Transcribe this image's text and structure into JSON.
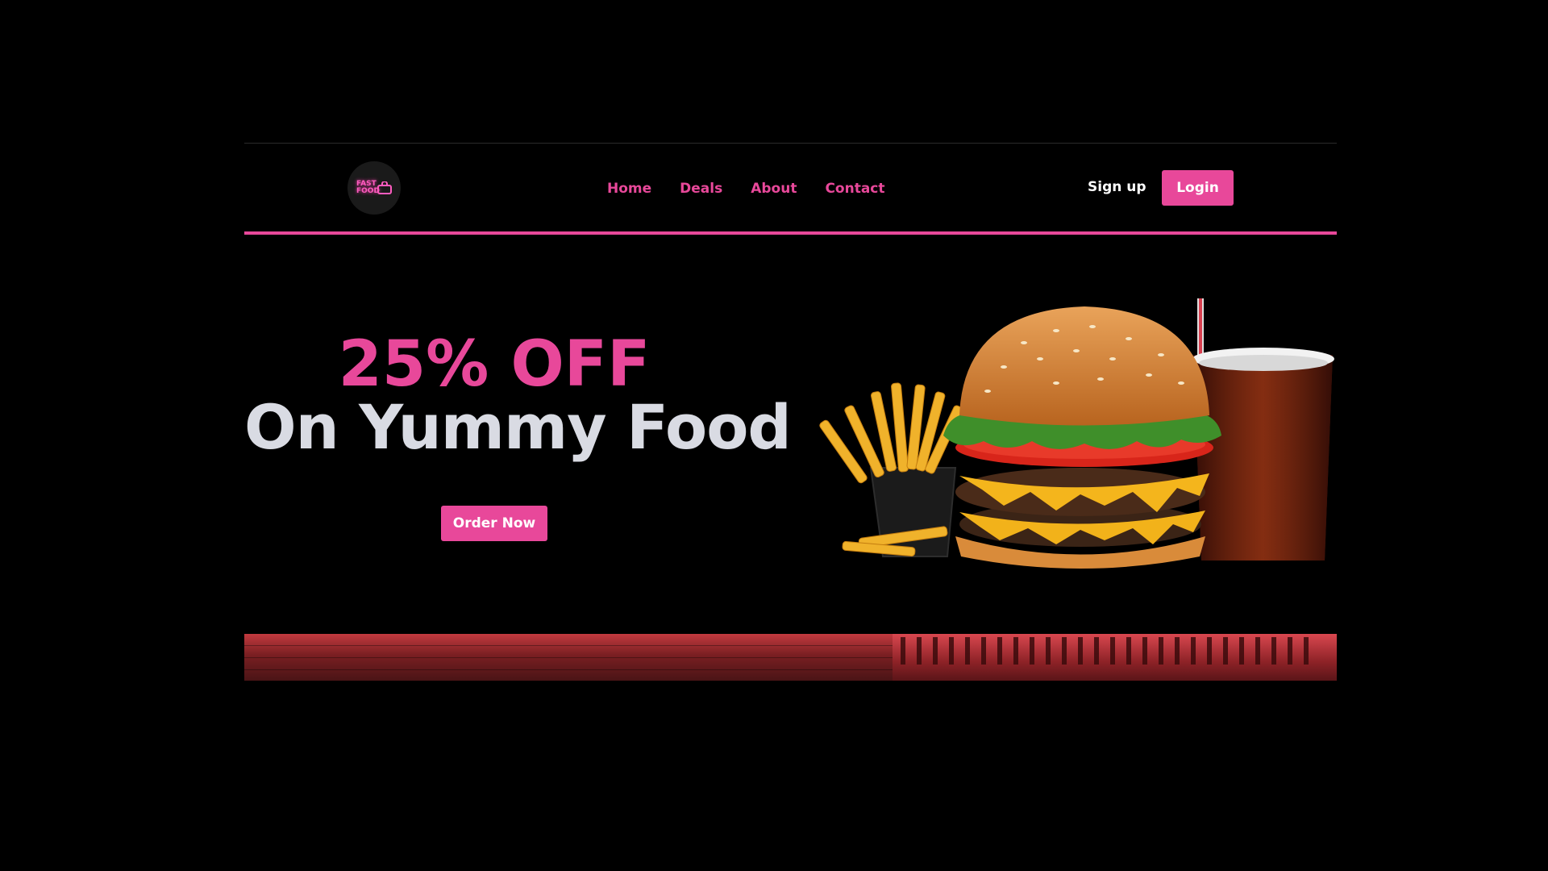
{
  "brand": {
    "logo_text": "FAST FOOD",
    "accent_color": "#e8489a",
    "background_color": "#000000"
  },
  "nav": {
    "items": [
      {
        "label": "Home"
      },
      {
        "label": "Deals"
      },
      {
        "label": "About"
      },
      {
        "label": "Contact"
      }
    ]
  },
  "auth": {
    "signup_label": "Sign up",
    "login_label": "Login"
  },
  "hero": {
    "offer": "25% OFF",
    "subtitle": "On Yummy Food",
    "cta_label": "Order Now",
    "image_icon": "burger-fries-drink-image"
  }
}
